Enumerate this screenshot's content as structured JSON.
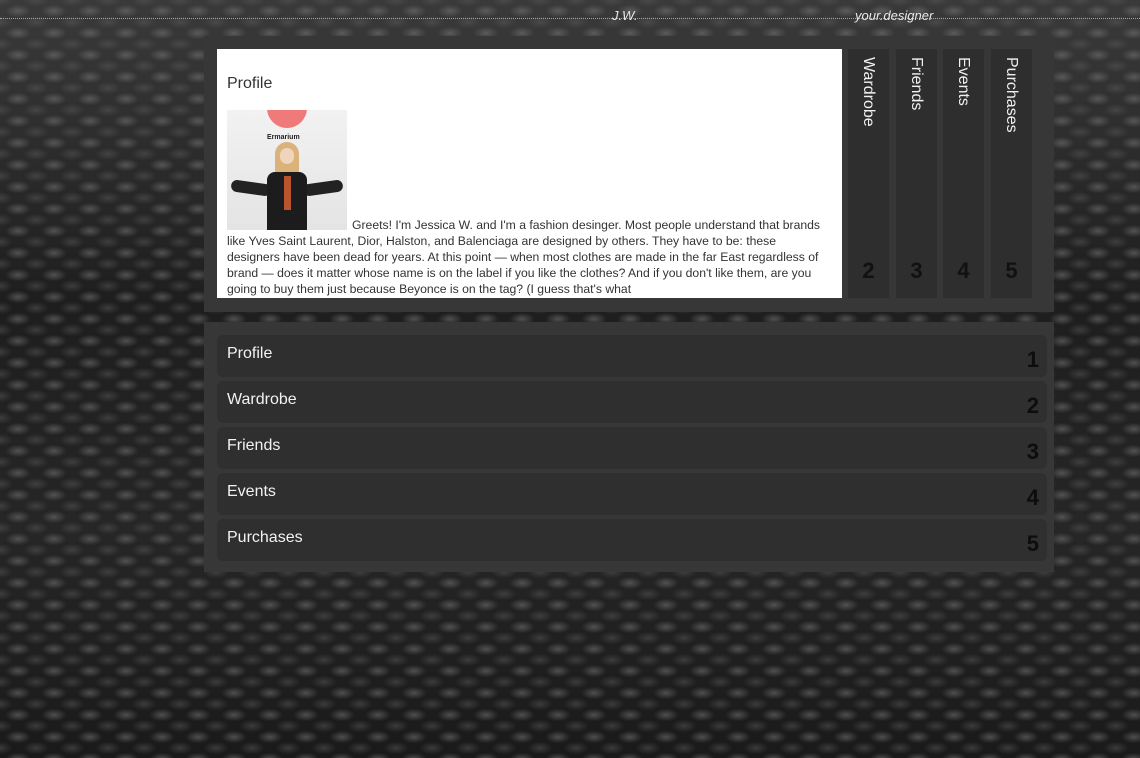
{
  "header": {
    "initials": "J.W.",
    "tagline": "your.designer"
  },
  "profile": {
    "title": "Profile",
    "photo_label": "Ermarium",
    "bio": "Greets! I'm Jessica W. and I'm a fashion desinger. Most people understand that brands like Yves Saint Laurent, Dior, Halston, and Balenciaga are designed by others. They have to be: these designers have been dead for years. At this point — when most clothes are made in the far East regardless of brand — does it matter whose name is on the label if you like the clothes? And if you don't like them, are you going to buy them just because Beyonce is on the tag? (I guess that's what"
  },
  "vertical_tabs": [
    {
      "label": "Wardrobe",
      "number": "2"
    },
    {
      "label": "Friends",
      "number": "3"
    },
    {
      "label": "Events",
      "number": "4"
    },
    {
      "label": "Purchases",
      "number": "5"
    }
  ],
  "menu": [
    {
      "label": "Profile",
      "number": "1"
    },
    {
      "label": "Wardrobe",
      "number": "2"
    },
    {
      "label": "Friends",
      "number": "3"
    },
    {
      "label": "Events",
      "number": "4"
    },
    {
      "label": "Purchases",
      "number": "5"
    }
  ]
}
